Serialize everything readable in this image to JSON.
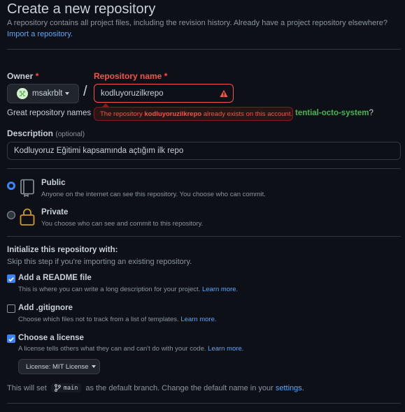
{
  "header": {
    "title": "Create a new repository",
    "desc": "A repository contains all project files, including the revision history. Already have a project repository elsewhere?",
    "import_link": "Import a repository."
  },
  "owner": {
    "label": "Owner",
    "required_mark": "*",
    "value": "msakrblt"
  },
  "slash": "/",
  "repo_name": {
    "label": "Repository name",
    "required_mark": "*",
    "value": "kodluyoruzilkrepo"
  },
  "error_tooltip": {
    "prefix": "The repository ",
    "repo": "kodluyoruzilkrepo",
    "suffix": " already exists on this account."
  },
  "suggestion": {
    "prefix": "Great repository names a",
    "name": "tential-octo-system",
    "suffix": "?"
  },
  "description": {
    "label": "Description",
    "optional": "(optional)",
    "value": "Kodluyoruz Eğitimi kapsamında açtığım ilk repo"
  },
  "visibility": {
    "public": {
      "title": "Public",
      "desc": "Anyone on the internet can see this repository. You choose who can commit.",
      "selected": true
    },
    "private": {
      "title": "Private",
      "desc": "You choose who can see and commit to this repository.",
      "selected": false
    }
  },
  "init": {
    "title": "Initialize this repository with:",
    "subtitle": "Skip this step if you're importing an existing repository.",
    "readme": {
      "title": "Add a README file",
      "desc": "This is where you can write a long description for your project.",
      "link": "Learn more.",
      "checked": true
    },
    "gitignore": {
      "title": "Add .gitignore",
      "desc": "Choose which files not to track from a list of templates.",
      "link": "Learn more.",
      "checked": false
    },
    "license": {
      "title": "Choose a license",
      "desc": "A license tells others what they can and can't do with your code.",
      "link": "Learn more.",
      "checked": true,
      "button": "License: MIT License"
    }
  },
  "branch_note": {
    "prefix": "This will set",
    "branch": "main",
    "middle": "as the default branch. Change the default name in your",
    "link": "settings",
    "suffix": "."
  },
  "colors": {
    "accent": "#58a6ff",
    "error": "#f85149",
    "success": "#3fb950",
    "checkbox": "#3b82f6"
  },
  "icons": {
    "public": "repo-icon",
    "private": "lock-icon",
    "error": "alert-icon",
    "branch": "git-branch-icon",
    "avatar": "identicon-avatar"
  }
}
